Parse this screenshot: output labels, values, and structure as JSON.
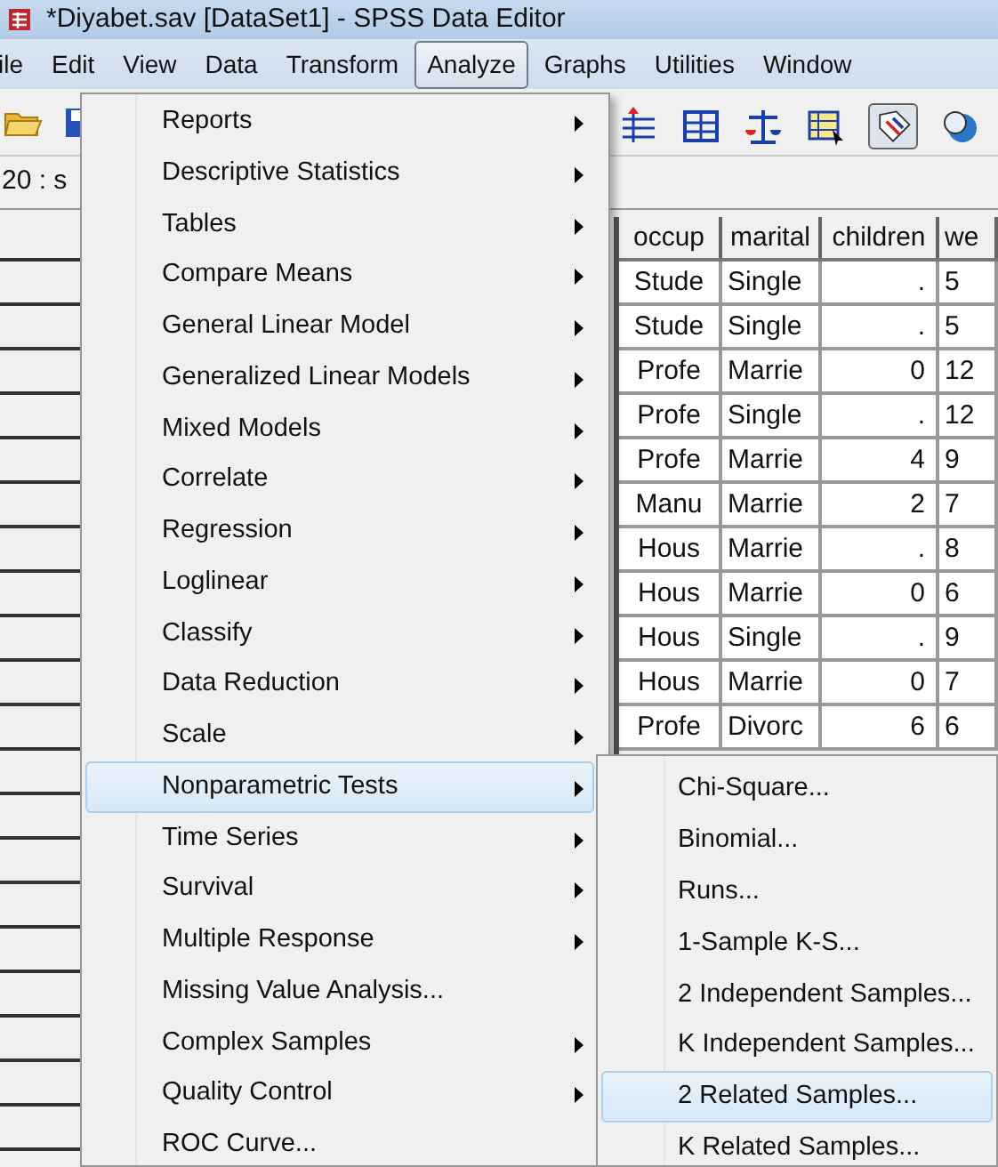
{
  "window": {
    "title": "*Diyabet.sav [DataSet1] - SPSS Data Editor"
  },
  "menu_bar": [
    {
      "label": "ile",
      "selected": false
    },
    {
      "label": "Edit",
      "selected": false
    },
    {
      "label": "View",
      "selected": false
    },
    {
      "label": "Data",
      "selected": false
    },
    {
      "label": "Transform",
      "selected": false
    },
    {
      "label": "Analyze",
      "selected": true
    },
    {
      "label": "Graphs",
      "selected": false
    },
    {
      "label": "Utilities",
      "selected": false
    },
    {
      "label": "Window",
      "selected": false
    }
  ],
  "cell_reference": "20 : s",
  "table": {
    "columns": [
      "occup",
      "marital",
      "children",
      "we"
    ],
    "rows": [
      [
        "Stude",
        "Single",
        ".",
        "5"
      ],
      [
        "Stude",
        "Single",
        ".",
        "5"
      ],
      [
        "Profe",
        "Marrie",
        "0",
        "12"
      ],
      [
        "Profe",
        "Single",
        ".",
        "12"
      ],
      [
        "Profe",
        "Marrie",
        "4",
        "9"
      ],
      [
        "Manu",
        "Marrie",
        "2",
        "7"
      ],
      [
        "Hous",
        "Marrie",
        ".",
        "8"
      ],
      [
        "Hous",
        "Marrie",
        "0",
        "6"
      ],
      [
        "Hous",
        "Single",
        ".",
        "9"
      ],
      [
        "Hous",
        "Marrie",
        "0",
        "7"
      ],
      [
        "Profe",
        "Divorc",
        "6",
        "6"
      ]
    ]
  },
  "analyze_menu": [
    {
      "label": "Reports",
      "submenu": true,
      "selected": false
    },
    {
      "label": "Descriptive Statistics",
      "submenu": true,
      "selected": false
    },
    {
      "label": "Tables",
      "submenu": true,
      "selected": false
    },
    {
      "label": "Compare Means",
      "submenu": true,
      "selected": false
    },
    {
      "label": "General Linear Model",
      "submenu": true,
      "selected": false
    },
    {
      "label": "Generalized Linear Models",
      "submenu": true,
      "selected": false
    },
    {
      "label": "Mixed Models",
      "submenu": true,
      "selected": false
    },
    {
      "label": "Correlate",
      "submenu": true,
      "selected": false
    },
    {
      "label": "Regression",
      "submenu": true,
      "selected": false
    },
    {
      "label": "Loglinear",
      "submenu": true,
      "selected": false
    },
    {
      "label": "Classify",
      "submenu": true,
      "selected": false
    },
    {
      "label": "Data Reduction",
      "submenu": true,
      "selected": false
    },
    {
      "label": "Scale",
      "submenu": true,
      "selected": false
    },
    {
      "label": "Nonparametric Tests",
      "submenu": true,
      "selected": true
    },
    {
      "label": "Time Series",
      "submenu": true,
      "selected": false
    },
    {
      "label": "Survival",
      "submenu": true,
      "selected": false
    },
    {
      "label": "Multiple Response",
      "submenu": true,
      "selected": false
    },
    {
      "label": "Missing Value Analysis...",
      "submenu": false,
      "selected": false
    },
    {
      "label": "Complex Samples",
      "submenu": true,
      "selected": false
    },
    {
      "label": "Quality Control",
      "submenu": true,
      "selected": false
    },
    {
      "label": "ROC Curve...",
      "submenu": false,
      "selected": false
    }
  ],
  "nonparametric_submenu": [
    {
      "label": "Chi-Square...",
      "selected": false
    },
    {
      "label": "Binomial...",
      "selected": false
    },
    {
      "label": "Runs...",
      "selected": false
    },
    {
      "label": "1-Sample K-S...",
      "selected": false
    },
    {
      "label": "2 Independent Samples...",
      "selected": false
    },
    {
      "label": "K Independent Samples...",
      "selected": false
    },
    {
      "label": "2 Related Samples...",
      "selected": true
    },
    {
      "label": "K Related Samples...",
      "selected": false
    }
  ]
}
